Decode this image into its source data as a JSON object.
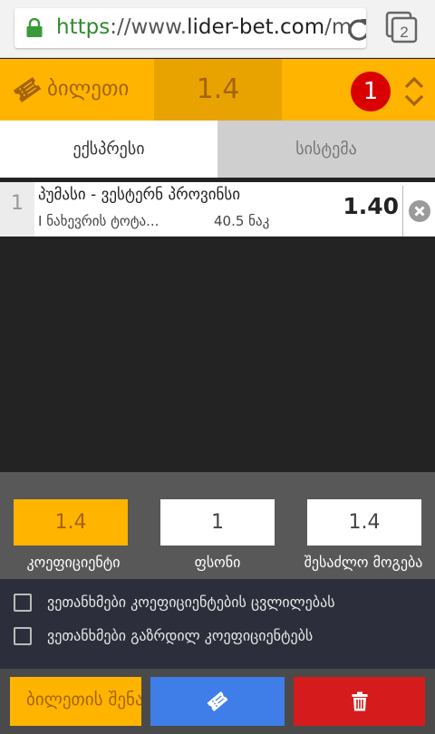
{
  "browser": {
    "url_scheme": "https",
    "url_sep": "://www.",
    "url_host": "lider-bet.com",
    "url_rest": "/m",
    "tab_count": "2"
  },
  "ticket": {
    "title": "ბილეთი",
    "total_odds": "1.4",
    "count": "1"
  },
  "tabs": [
    {
      "label": "ექსპრესი",
      "active": true
    },
    {
      "label": "სისტემა",
      "active": false
    }
  ],
  "bets": [
    {
      "index": "1",
      "match": "პუმასი - ვესტერნ პროვინსი",
      "market": "I ნახევრის ტოტა...",
      "selection": "40.5 ნაკ",
      "odds": "1.40"
    }
  ],
  "calc": {
    "coef_value": "1.4",
    "stake_value": "1",
    "win_value": "1.4",
    "coef_label": "კოეფიციენტი",
    "stake_label": "ფსონი",
    "win_label": "შესაძლო მოგება"
  },
  "agreements": [
    {
      "label": "ვეთანხმები კოეფიციენტების ცვლილებას",
      "checked": false
    },
    {
      "label": "ვეთანხმები გაზრდილ კოეფიციენტებს",
      "checked": false
    }
  ],
  "actions": {
    "save_label": "ბილეთის შენახვა"
  },
  "colors": {
    "accent": "#ffb400",
    "accent_dark": "#e8a300",
    "accent_text": "#a4640a",
    "badge": "#d90000",
    "place": "#3f7de8",
    "delete": "#d51b1b"
  }
}
